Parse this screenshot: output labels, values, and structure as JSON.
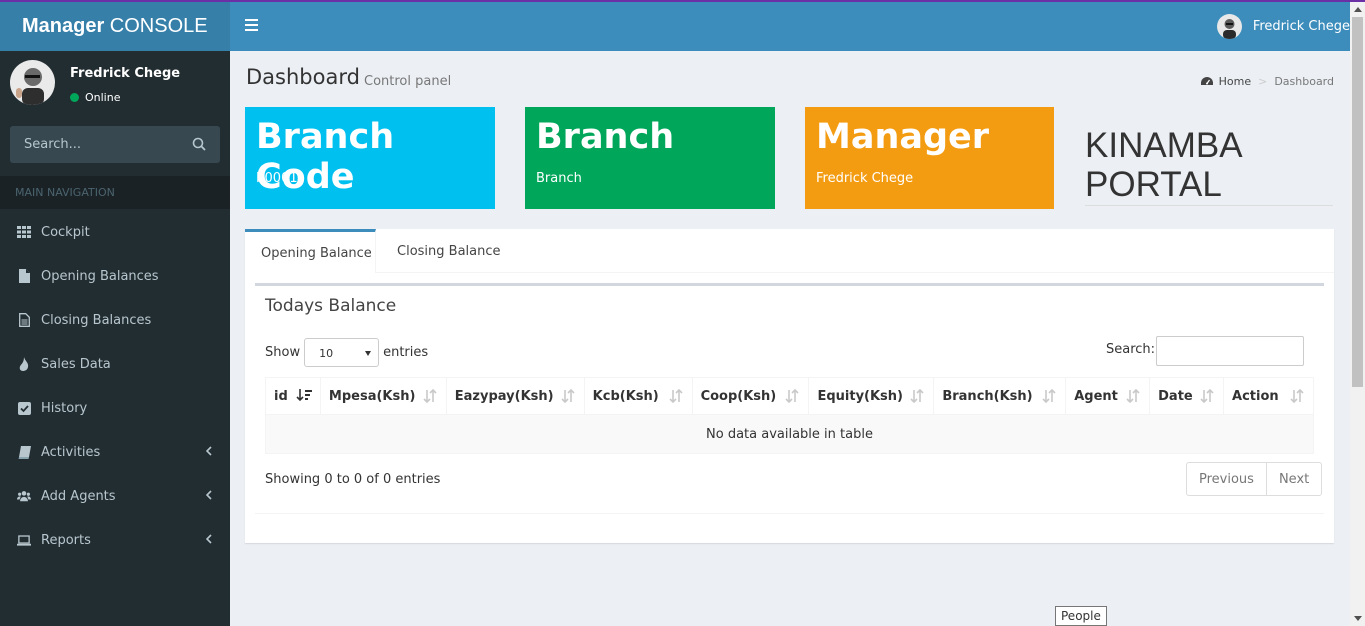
{
  "brand": {
    "bold": "Manager",
    "rest": " CONSOLE"
  },
  "header": {
    "user_name": "Fredrick Chege"
  },
  "sidebar": {
    "user_name": "Fredrick Chege",
    "status": "Online",
    "search_placeholder": "Search...",
    "section_header": "MAIN NAVIGATION",
    "items": [
      {
        "label": "Cockpit",
        "icon": "th-icon"
      },
      {
        "label": "Opening Balances",
        "icon": "file-icon"
      },
      {
        "label": "Closing Balances",
        "icon": "file-text-icon"
      },
      {
        "label": "Sales Data",
        "icon": "fire-icon"
      },
      {
        "label": "History",
        "icon": "check-square-icon"
      },
      {
        "label": "Activities",
        "icon": "book-icon"
      },
      {
        "label": "Add Agents",
        "icon": "users-icon"
      },
      {
        "label": "Reports",
        "icon": "laptop-icon"
      }
    ]
  },
  "page": {
    "title": "Dashboard",
    "subtitle": "Control panel",
    "breadcrumb": {
      "home": "Home",
      "current": "Dashboard"
    }
  },
  "info_boxes": [
    {
      "big": "Branch Code",
      "small": "K0001",
      "color": "#00c0ef"
    },
    {
      "big": "Branch",
      "small": "Branch",
      "color": "#00a65a"
    },
    {
      "big": "Manager",
      "small": "Fredrick Chege",
      "color": "#f39c12"
    }
  ],
  "portal": {
    "line1": "KINAMBA",
    "line2": "PORTAL"
  },
  "tabs": [
    {
      "label": "Opening Balance"
    },
    {
      "label": "Closing Balance"
    }
  ],
  "table_box": {
    "title": "Todays Balance",
    "show_label": "Show",
    "entries_value": "10",
    "entries_label": "entries",
    "search_label": "Search:",
    "columns": [
      "id",
      "Mpesa(Ksh)",
      "Eazypay(Ksh)",
      "Kcb(Ksh)",
      "Coop(Ksh)",
      "Equity(Ksh)",
      "Branch(Ksh)",
      "Agent",
      "Date",
      "Action"
    ],
    "empty_message": "No data available in table",
    "info": "Showing 0 to 0 of 0 entries",
    "prev": "Previous",
    "next": "Next"
  },
  "tooltip": "People"
}
